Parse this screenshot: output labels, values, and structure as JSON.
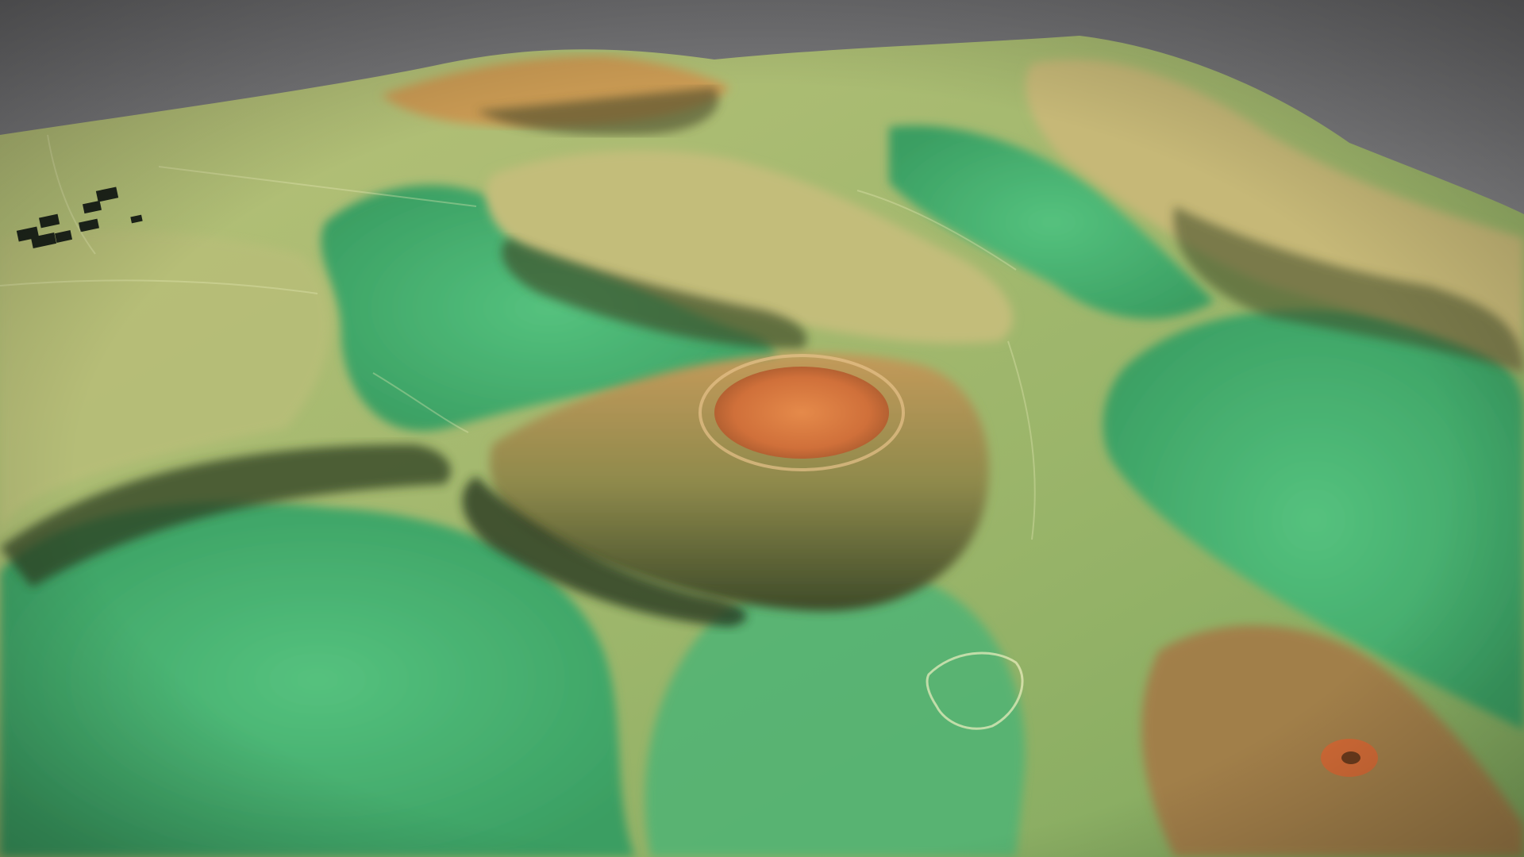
{
  "image": {
    "subject": "terrain-relief-render",
    "colors": {
      "sky_top": "#6f6f71",
      "sky_bottom": "#b7b7b9",
      "lowland": "#3fae6a",
      "lowland_light": "#52bd7a",
      "slope": "#a6b96a",
      "upland": "#c7c17a",
      "ridge": "#c99a52",
      "summit": "#d9733a",
      "shadow": "#2b3a1e",
      "building": "#1d241a"
    }
  }
}
